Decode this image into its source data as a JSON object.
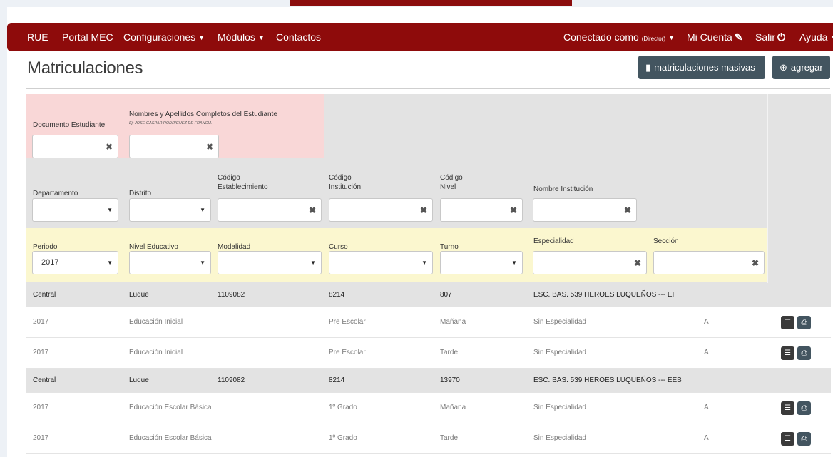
{
  "nav": {
    "items": [
      {
        "id": "rue",
        "label": "RUE"
      },
      {
        "id": "portal",
        "label": "Portal MEC"
      },
      {
        "id": "config",
        "label": "Configuraciones"
      },
      {
        "id": "modulos",
        "label": "Módulos"
      },
      {
        "id": "contactos",
        "label": "Contactos"
      }
    ],
    "connected_label": "Conectado como",
    "connected_role": "(Director)",
    "account_label": "Mi Cuenta",
    "logout_label": "Salir",
    "help_label": "Ayuda",
    "icons": {
      "account": "edit-icon",
      "logout": "power-icon"
    }
  },
  "page": {
    "title": "Matriculaciones",
    "mass_button": "matriculaciones masivas",
    "add_button": "agregar"
  },
  "filters": {
    "documento": {
      "label": "Documento Estudiante",
      "value": ""
    },
    "nombres": {
      "label": "Nombres y Apellidos Completos del Estudiante",
      "hint": "Ej: JOSE GASPAR RODRIGUEZ DE FRANCIA",
      "value": ""
    },
    "departamento": {
      "label": "Departamento",
      "value": ""
    },
    "distrito": {
      "label": "Distrito",
      "value": ""
    },
    "cod_establecimiento": {
      "label1": "Código",
      "label2": "Establecimiento",
      "value": ""
    },
    "cod_institucion": {
      "label1": "Código",
      "label2": "Institución",
      "value": ""
    },
    "cod_nivel": {
      "label1": "Código",
      "label2": "Nivel",
      "value": ""
    },
    "nombre_institucion": {
      "label": "Nombre Institución",
      "value": ""
    },
    "periodo": {
      "label": "Periodo",
      "value": "2017"
    },
    "nivel_educativo": {
      "label": "Nivel Educativo",
      "value": ""
    },
    "modalidad": {
      "label": "Modalidad",
      "value": ""
    },
    "curso": {
      "label": "Curso",
      "value": ""
    },
    "turno": {
      "label": "Turno",
      "value": ""
    },
    "especialidad": {
      "label": "Especialidad",
      "value": ""
    },
    "seccion": {
      "label": "Sección",
      "value": ""
    }
  },
  "colors": {
    "navbar": "#8e0b0b",
    "pink_filter": "#f9d7d7",
    "yellow_filter": "#fbf7cf",
    "button": "#435560"
  },
  "groups": [
    {
      "departamento": "Central",
      "distrito": "Luque",
      "cod_establecimiento": "1109082",
      "cod_institucion": "8214",
      "cod_nivel": "807",
      "nombre": "ESC. BAS. 539 HEROES LUQUEÑOS --- EI",
      "rows": [
        {
          "periodo": "2017",
          "nivel": "Educación Inicial",
          "curso": "Pre Escolar",
          "turno": "Mañana",
          "especialidad": "Sin Especialidad",
          "seccion": "A"
        },
        {
          "periodo": "2017",
          "nivel": "Educación Inicial",
          "curso": "Pre Escolar",
          "turno": "Tarde",
          "especialidad": "Sin Especialidad",
          "seccion": "A"
        }
      ]
    },
    {
      "departamento": "Central",
      "distrito": "Luque",
      "cod_establecimiento": "1109082",
      "cod_institucion": "8214",
      "cod_nivel": "13970",
      "nombre": "ESC. BAS. 539 HEROES LUQUEÑOS --- EEB",
      "rows": [
        {
          "periodo": "2017",
          "nivel": "Educación Escolar Básica",
          "curso": "1º Grado",
          "turno": "Mañana",
          "especialidad": "Sin Especialidad",
          "seccion": "A"
        },
        {
          "periodo": "2017",
          "nivel": "Educación Escolar Básica",
          "curso": "1º Grado",
          "turno": "Tarde",
          "especialidad": "Sin Especialidad",
          "seccion": "A"
        }
      ]
    }
  ]
}
